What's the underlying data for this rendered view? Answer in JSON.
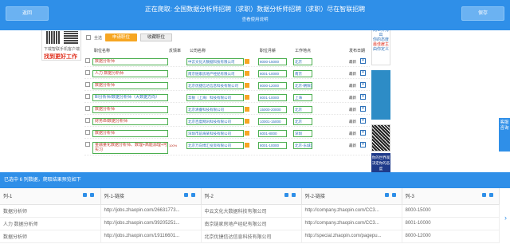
{
  "toolbar": {
    "back_label": "返回",
    "save_label": "保存",
    "title": "正在爬取: 全国数据分析师招聘（求职）数据分析师招聘（求职）尽在智联招聘",
    "subtitle": "查看使用说明"
  },
  "page": {
    "ad_left_caption": "下载智联手机客户端",
    "ad_left_slogan": "找到更好工作",
    "select_all": "全选",
    "apply_label": "申请职位",
    "fav_label": "收藏职位",
    "headers": [
      "职位名称",
      "反馈率",
      "公司名称",
      "职位月薪",
      "工作地点",
      "发布日期"
    ],
    "rows": [
      {
        "job": "数据分析师",
        "pct": "",
        "company": "中云文化大数据科技有限公司",
        "salary": "8000-15000",
        "location": "北京",
        "date": "最新"
      },
      {
        "job": "人力 数据分析师",
        "pct": "",
        "company": "南京链家房地产经纪有限公司",
        "salary": "8001-10000",
        "location": "南京",
        "date": "最新"
      },
      {
        "job": "数据分析师",
        "pct": "",
        "company": "北京优捷信达信息科技有限公司",
        "salary": "8000-12000",
        "location": "北京-朝阳区",
        "date": "最新"
      },
      {
        "job": "BI分析师/数据分析师（大数据方向）",
        "pct": "",
        "company": "华银（上海）科技有限公司",
        "salary": "8001-10000",
        "location": "上海",
        "date": "最新"
      },
      {
        "job": "数据分析师",
        "pct": "",
        "company": "北京清睿科技有限公司",
        "salary": "15000-20000",
        "location": "北京",
        "date": "最新"
      },
      {
        "job": "财务/BI数据分析师",
        "pct": "",
        "company": "北京百度网讯科技有限公司",
        "salary": "10001-15000",
        "location": "北京",
        "date": "最新"
      },
      {
        "job": "数据分析师",
        "pct": "",
        "company": "深圳市前海某科技有限公司",
        "salary": "6001-8000",
        "location": "深圳",
        "date": "最新"
      },
      {
        "job": "金融量化数据分析师、数理+高能源理+可实习",
        "pct": "100%",
        "company": "北京万向博汇投资有限公司",
        "salary": "8001-10000",
        "location": "北京-东城区",
        "date": "最新"
      }
    ],
    "ad_right_text": [
      "向世界秀出",
      "你的态度",
      "最佳雇主",
      "由你定义"
    ],
    "ad_right_bottom": "你的世界观决定你的态度",
    "side_tab": "客服咨询"
  },
  "preview": {
    "header": "已选中 6 列数据，爬取结果预览如下",
    "columns": [
      "列-1",
      "列-1-链接",
      "列-2",
      "列-2-链接",
      "列-3"
    ],
    "rows": [
      [
        "数据分析师",
        "http://jobs.zhaopin.com/26631773...",
        "中云文化大数据科技有限公司",
        "http://company.zhaopin.com/CC3...",
        "8000-15000"
      ],
      [
        "人力 数据分析师",
        "http://jobs.zhaopin.com/39205251...",
        "南京链家房地产经纪有限公司",
        "http://company.zhaopin.com/CC3...",
        "8001-10000"
      ],
      [
        "数据分析师",
        "http://jobs.zhaopin.com/19116601...",
        "北京优捷信达信息科技有限公司",
        "http://special.zhaopin.com/pagepu...",
        "8000-12000"
      ]
    ]
  },
  "colors": {
    "accent": "#2f8fe8",
    "apply": "#f6a623",
    "highlight": "#4caf50"
  }
}
